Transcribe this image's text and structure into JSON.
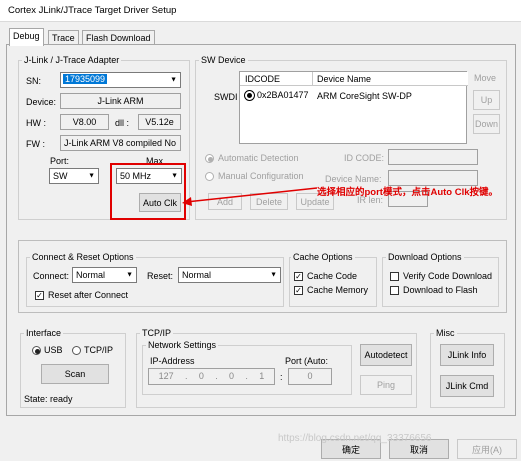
{
  "window": {
    "title": "Cortex JLink/JTrace Target Driver Setup"
  },
  "tabs": [
    "Debug",
    "Trace",
    "Flash Download"
  ],
  "adapter": {
    "group_label": "J-Link / J-Trace Adapter",
    "sn_label": "SN:",
    "sn_value": "17935099",
    "device_label": "Device:",
    "device_value": "J-Link ARM",
    "hw_label": "HW :",
    "hw_value": "V8.00",
    "dll_label": "dll :",
    "dll_value": "V5.12e",
    "fw_label": "FW :",
    "fw_value": "J-Link ARM V8 compiled No",
    "port_label": "Port:",
    "port_value": "SW",
    "max_label": "Max",
    "max_value": "50 MHz",
    "auto_clk": "Auto Clk"
  },
  "sw_device": {
    "group_label": "SW Device",
    "col_idcode": "IDCODE",
    "col_device_name": "Device Name",
    "row_label": "SWDI",
    "row_idcode": "0x2BA01477",
    "row_device": "ARM CoreSight SW-DP",
    "move_label": "Move",
    "up": "Up",
    "down": "Down",
    "auto_detection": "Automatic Detection",
    "manual_configuration": "Manual Configuration",
    "id_code_label": "ID CODE:",
    "device_name_label": "Device Name:",
    "ir_len_label": "IR len:",
    "add": "Add",
    "delete": "Delete",
    "update": "Update"
  },
  "annotation": "选择相应的port模式，点击Auto Clk按键。",
  "connect_reset": {
    "group_label": "Connect & Reset Options",
    "connect_label": "Connect:",
    "connect_value": "Normal",
    "reset_label": "Reset:",
    "reset_value": "Normal",
    "reset_after_connect": "Reset after Connect"
  },
  "cache": {
    "group_label": "Cache Options",
    "cache_code": "Cache Code",
    "cache_memory": "Cache Memory"
  },
  "download": {
    "group_label": "Download Options",
    "verify": "Verify Code Download",
    "download_to_flash": "Download to Flash"
  },
  "interface": {
    "group_label": "Interface",
    "usb": "USB",
    "tcpip": "TCP/IP",
    "scan": "Scan",
    "state": "State: ready"
  },
  "tcpip": {
    "group_label": "TCP/IP",
    "network_settings": "Network Settings",
    "ip_label": "IP-Address",
    "ip": [
      "127",
      "0",
      "0",
      "1"
    ],
    "port_label": "Port (Auto:",
    "port_value": "0",
    "autodetect": "Autodetect",
    "ping": "Ping"
  },
  "misc": {
    "group_label": "Misc",
    "jlink_info": "JLink Info",
    "jlink_cmd": "JLink Cmd"
  },
  "footer": {
    "ok": "确定",
    "cancel": "取消",
    "apply": "应用(A)"
  },
  "watermark": "https://blog.csdn.net/qq_33376656"
}
